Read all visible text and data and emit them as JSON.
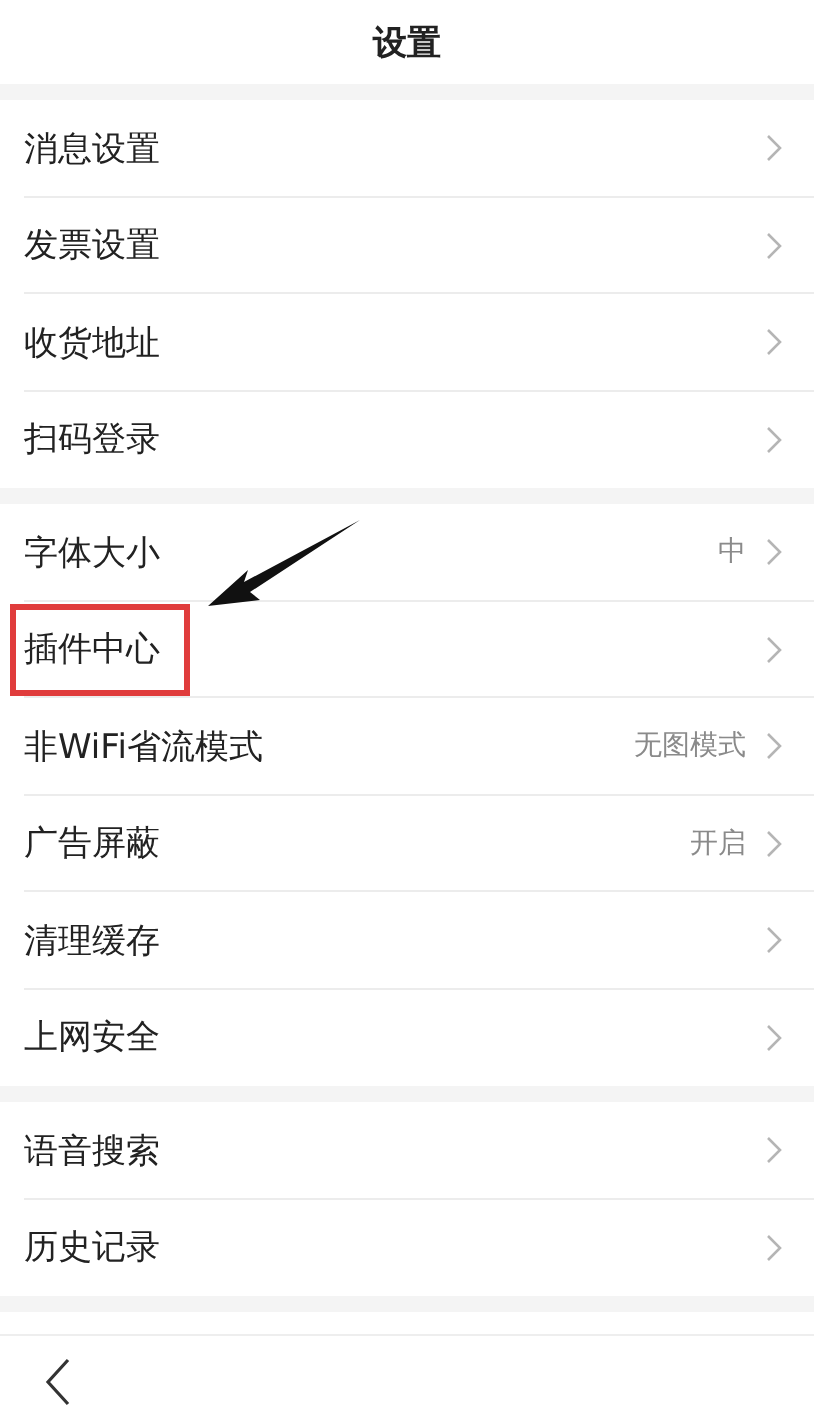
{
  "header": {
    "title": "设置"
  },
  "groups": [
    {
      "items": [
        {
          "label": "消息设置",
          "highlighted": false
        },
        {
          "label": "发票设置",
          "highlighted": false
        },
        {
          "label": "收货地址",
          "highlighted": false
        },
        {
          "label": "扫码登录",
          "highlighted": false
        }
      ]
    },
    {
      "items": [
        {
          "label": "字体大小",
          "value": "中",
          "highlighted": false
        },
        {
          "label": "插件中心",
          "highlighted": true
        },
        {
          "label": "非WiFi省流模式",
          "value": "无图模式",
          "highlighted": false
        },
        {
          "label": "广告屏蔽",
          "value": "开启",
          "highlighted": false
        },
        {
          "label": "清理缓存",
          "highlighted": false
        },
        {
          "label": "上网安全",
          "highlighted": false
        }
      ]
    },
    {
      "items": [
        {
          "label": "语音搜索",
          "highlighted": false
        },
        {
          "label": "历史记录",
          "highlighted": false
        }
      ]
    }
  ]
}
